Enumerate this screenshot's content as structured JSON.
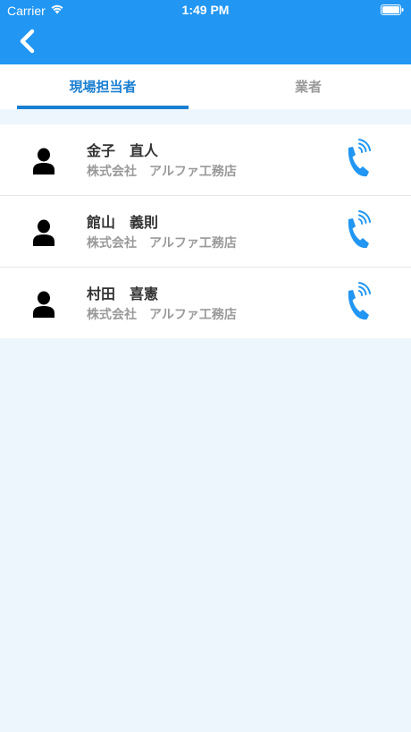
{
  "status_bar": {
    "carrier": "Carrier",
    "time": "1:49 PM"
  },
  "tabs": [
    {
      "label": "現場担当者",
      "active": true
    },
    {
      "label": "業者",
      "active": false
    }
  ],
  "contacts": [
    {
      "name": "金子　直人",
      "company": "株式会社　アルファ工務店"
    },
    {
      "name": "館山　義則",
      "company": "株式会社　アルファ工務店"
    },
    {
      "name": "村田　喜憲",
      "company": "株式会社　アルファ工務店"
    }
  ],
  "icons": {
    "back": "chevron-left-icon",
    "avatar": "person-icon",
    "call": "phone-icon"
  },
  "colors": {
    "primary": "#2196f3",
    "tab_active": "#1a7fd1",
    "phone": "#2196f3",
    "background": "#eef6fd"
  }
}
